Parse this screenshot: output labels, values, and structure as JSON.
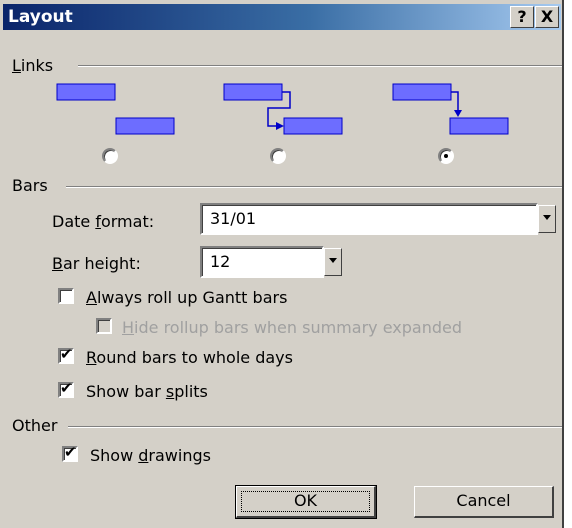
{
  "window": {
    "title": "Layout",
    "help_label": "?",
    "close_label": "X"
  },
  "links": {
    "label": "Links",
    "selected_option": 3
  },
  "bars": {
    "label": "Bars",
    "date_format": {
      "label": "Date format:",
      "value": "31/01"
    },
    "bar_height": {
      "label": "Bar height:",
      "value": "12"
    },
    "checkboxes": [
      {
        "label": "Always roll up Gantt bars",
        "checked": false,
        "enabled": true
      },
      {
        "label": "Hide rollup bars when summary expanded",
        "checked": false,
        "enabled": false
      },
      {
        "label": "Round bars to whole days",
        "checked": true,
        "enabled": true
      },
      {
        "label": "Show bar splits",
        "checked": true,
        "enabled": true
      }
    ]
  },
  "other": {
    "label": "Other",
    "checkboxes": [
      {
        "label": "Show drawings",
        "checked": true,
        "enabled": true
      }
    ]
  },
  "buttons": {
    "ok": "OK",
    "cancel": "Cancel"
  },
  "colors": {
    "link_bar": "#6d6dff",
    "link_line": "#0000c8",
    "title_start": "#0a246a",
    "title_end": "#a6caf0",
    "dialog_bg": "#d4d0c8"
  }
}
